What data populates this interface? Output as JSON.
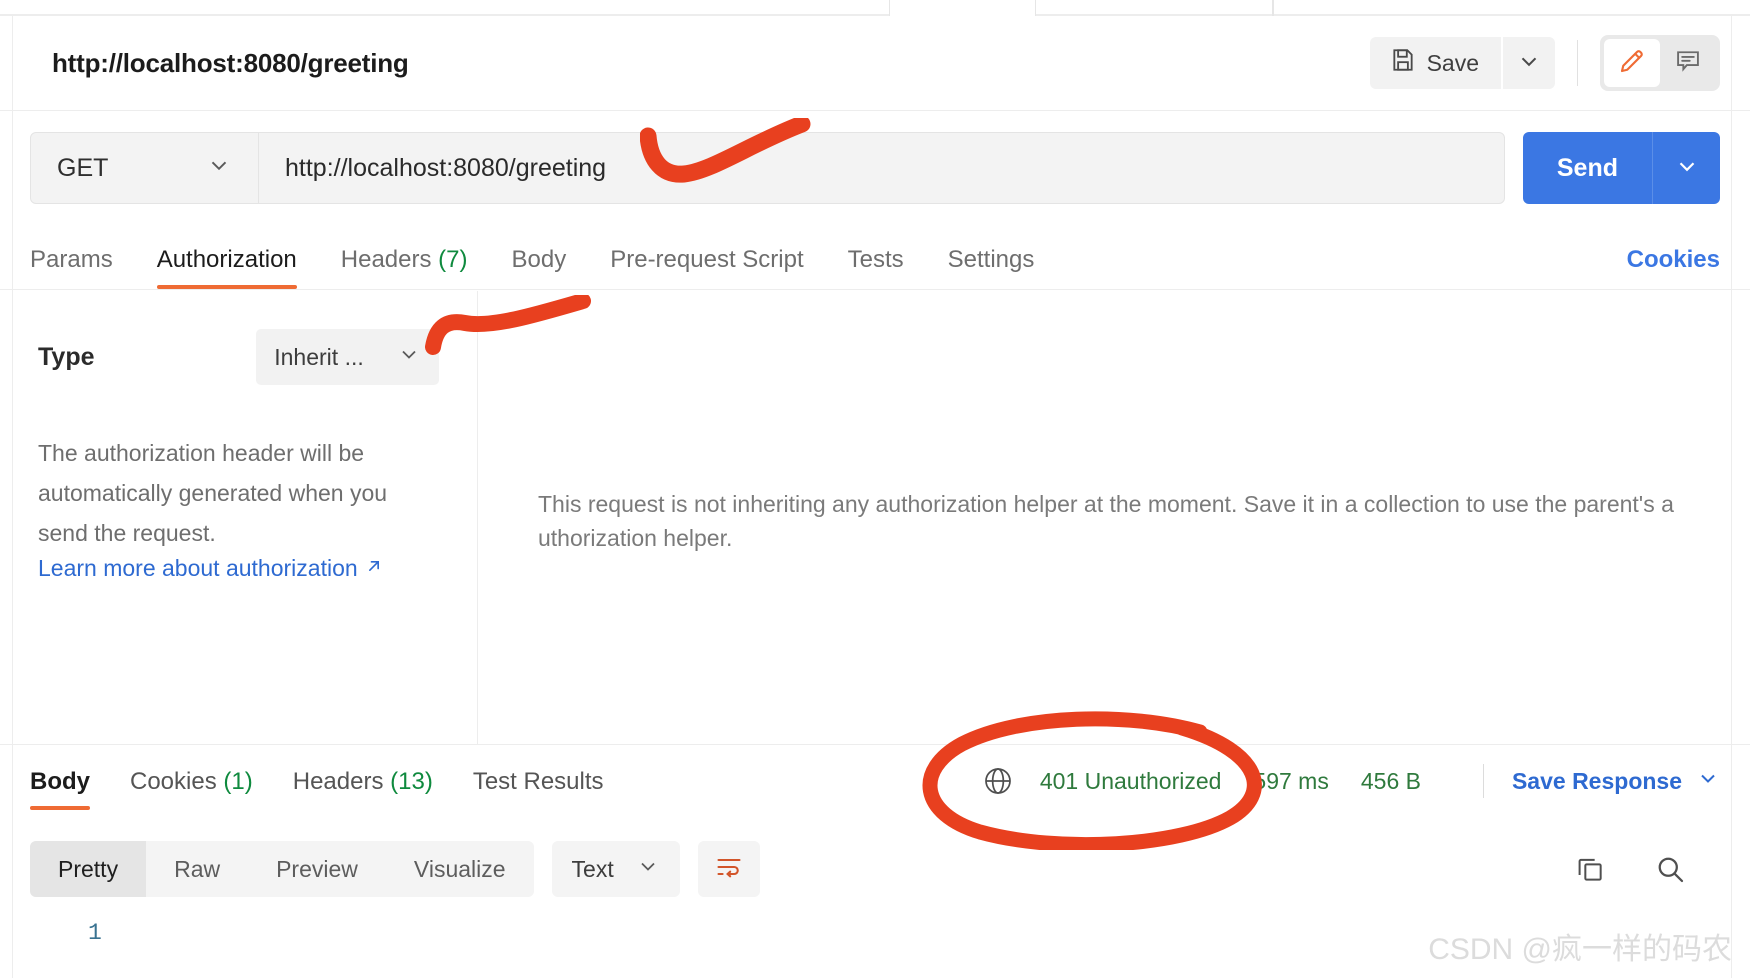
{
  "request": {
    "title": "http://localhost:8080/greeting",
    "method": "GET",
    "url": "http://localhost:8080/greeting",
    "send_label": "Send"
  },
  "toolbar": {
    "save_label": "Save",
    "save_icon": "floppy-disk-icon",
    "save_caret_icon": "chevron-down-icon",
    "edit_icon": "pencil-icon",
    "comment_icon": "comment-icon"
  },
  "request_tabs": [
    {
      "label": "Params",
      "count": "",
      "active": false
    },
    {
      "label": "Authorization",
      "count": "",
      "active": true
    },
    {
      "label": "Headers",
      "count": "(7)",
      "active": false
    },
    {
      "label": "Body",
      "count": "",
      "active": false
    },
    {
      "label": "Pre-request Script",
      "count": "",
      "active": false
    },
    {
      "label": "Tests",
      "count": "",
      "active": false
    },
    {
      "label": "Settings",
      "count": "",
      "active": false
    }
  ],
  "cookies_link": "Cookies",
  "auth": {
    "type_label": "Type",
    "type_value": "Inherit ...",
    "description": "The authorization header will be automatically generated when you send the request.",
    "learn_more": "Learn more about authorization",
    "learn_more_icon": "external-link-arrow-icon",
    "message": "This request is not inheriting any authorization helper at the moment. Save it in a collection to use the parent's authorization helper."
  },
  "response_tabs": [
    {
      "label": "Body",
      "count": "",
      "active": true
    },
    {
      "label": "Cookies",
      "count": "(1)",
      "active": false
    },
    {
      "label": "Headers",
      "count": "(13)",
      "active": false
    },
    {
      "label": "Test Results",
      "count": "",
      "active": false
    }
  ],
  "response_status": {
    "globe_icon": "globe-icon",
    "status": "401 Unauthorized",
    "time": "597 ms",
    "size": "456 B",
    "save_response_label": "Save Response",
    "save_response_caret": "chevron-down-icon",
    "status_color": "#2f7a3d"
  },
  "body_toolbar": {
    "views": [
      {
        "label": "Pretty",
        "active": true
      },
      {
        "label": "Raw",
        "active": false
      },
      {
        "label": "Preview",
        "active": false
      },
      {
        "label": "Visualize",
        "active": false
      }
    ],
    "format": "Text",
    "format_caret_icon": "chevron-down-icon",
    "wrap_icon": "wrap-lines-icon",
    "copy_icon": "copy-icon",
    "search_icon": "search-icon"
  },
  "body_content": {
    "line_number": "1"
  },
  "watermark": "CSDN @疯一样的码农",
  "colors": {
    "accent_orange": "#ef6b34",
    "link_blue": "#2e6ad1",
    "send_blue": "#3b77e3",
    "status_green": "#2f7a3d",
    "annotation_red": "#e8401f"
  }
}
